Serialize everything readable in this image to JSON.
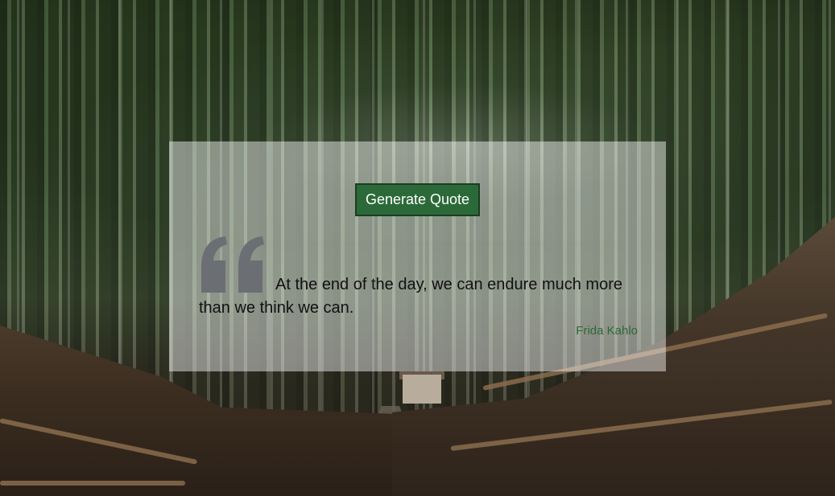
{
  "generate_button": {
    "label": "Generate Quote"
  },
  "quote": {
    "icon": "quote-mark-icon",
    "text": "At the end of the day, we can endure much more than we think we can.",
    "author": "Frida Kahlo"
  },
  "colors": {
    "button_bg": "#2b6a38",
    "button_text": "#ffffff",
    "author_text": "#2b6a38",
    "quote_icon": "#6b6f73",
    "card_bg": "rgba(255,255,255,0.45)"
  },
  "background": {
    "description_icon": "bamboo-forest-background"
  }
}
